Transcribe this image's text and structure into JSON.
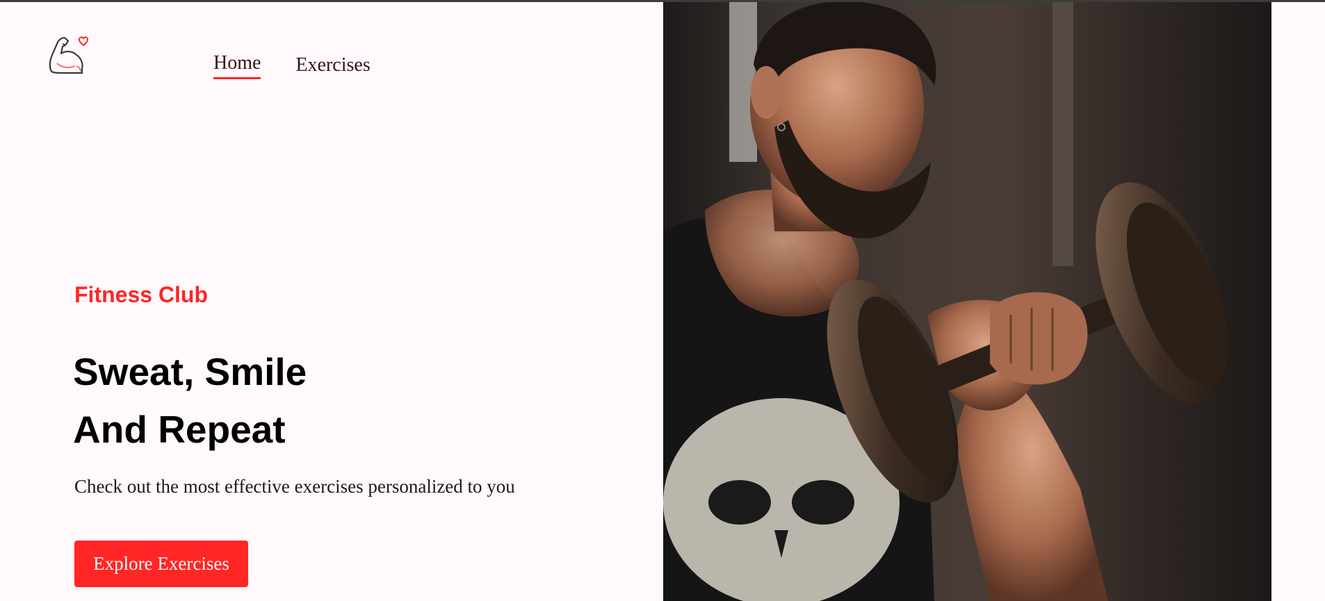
{
  "brand": {
    "logo_icon": "flexed-bicep-heart-icon",
    "accent_color": "#ff2625"
  },
  "nav": {
    "items": [
      {
        "label": "Home",
        "active": true
      },
      {
        "label": "Exercises",
        "active": false
      }
    ]
  },
  "hero": {
    "label": "Fitness Club",
    "title_line1": "Sweat, Smile",
    "title_line2": "And Repeat",
    "subtitle": "Check out the most effective exercises personalized to you",
    "cta_label": "Explore Exercises",
    "image_subject": "man-lifting-dumbbell-photo"
  }
}
